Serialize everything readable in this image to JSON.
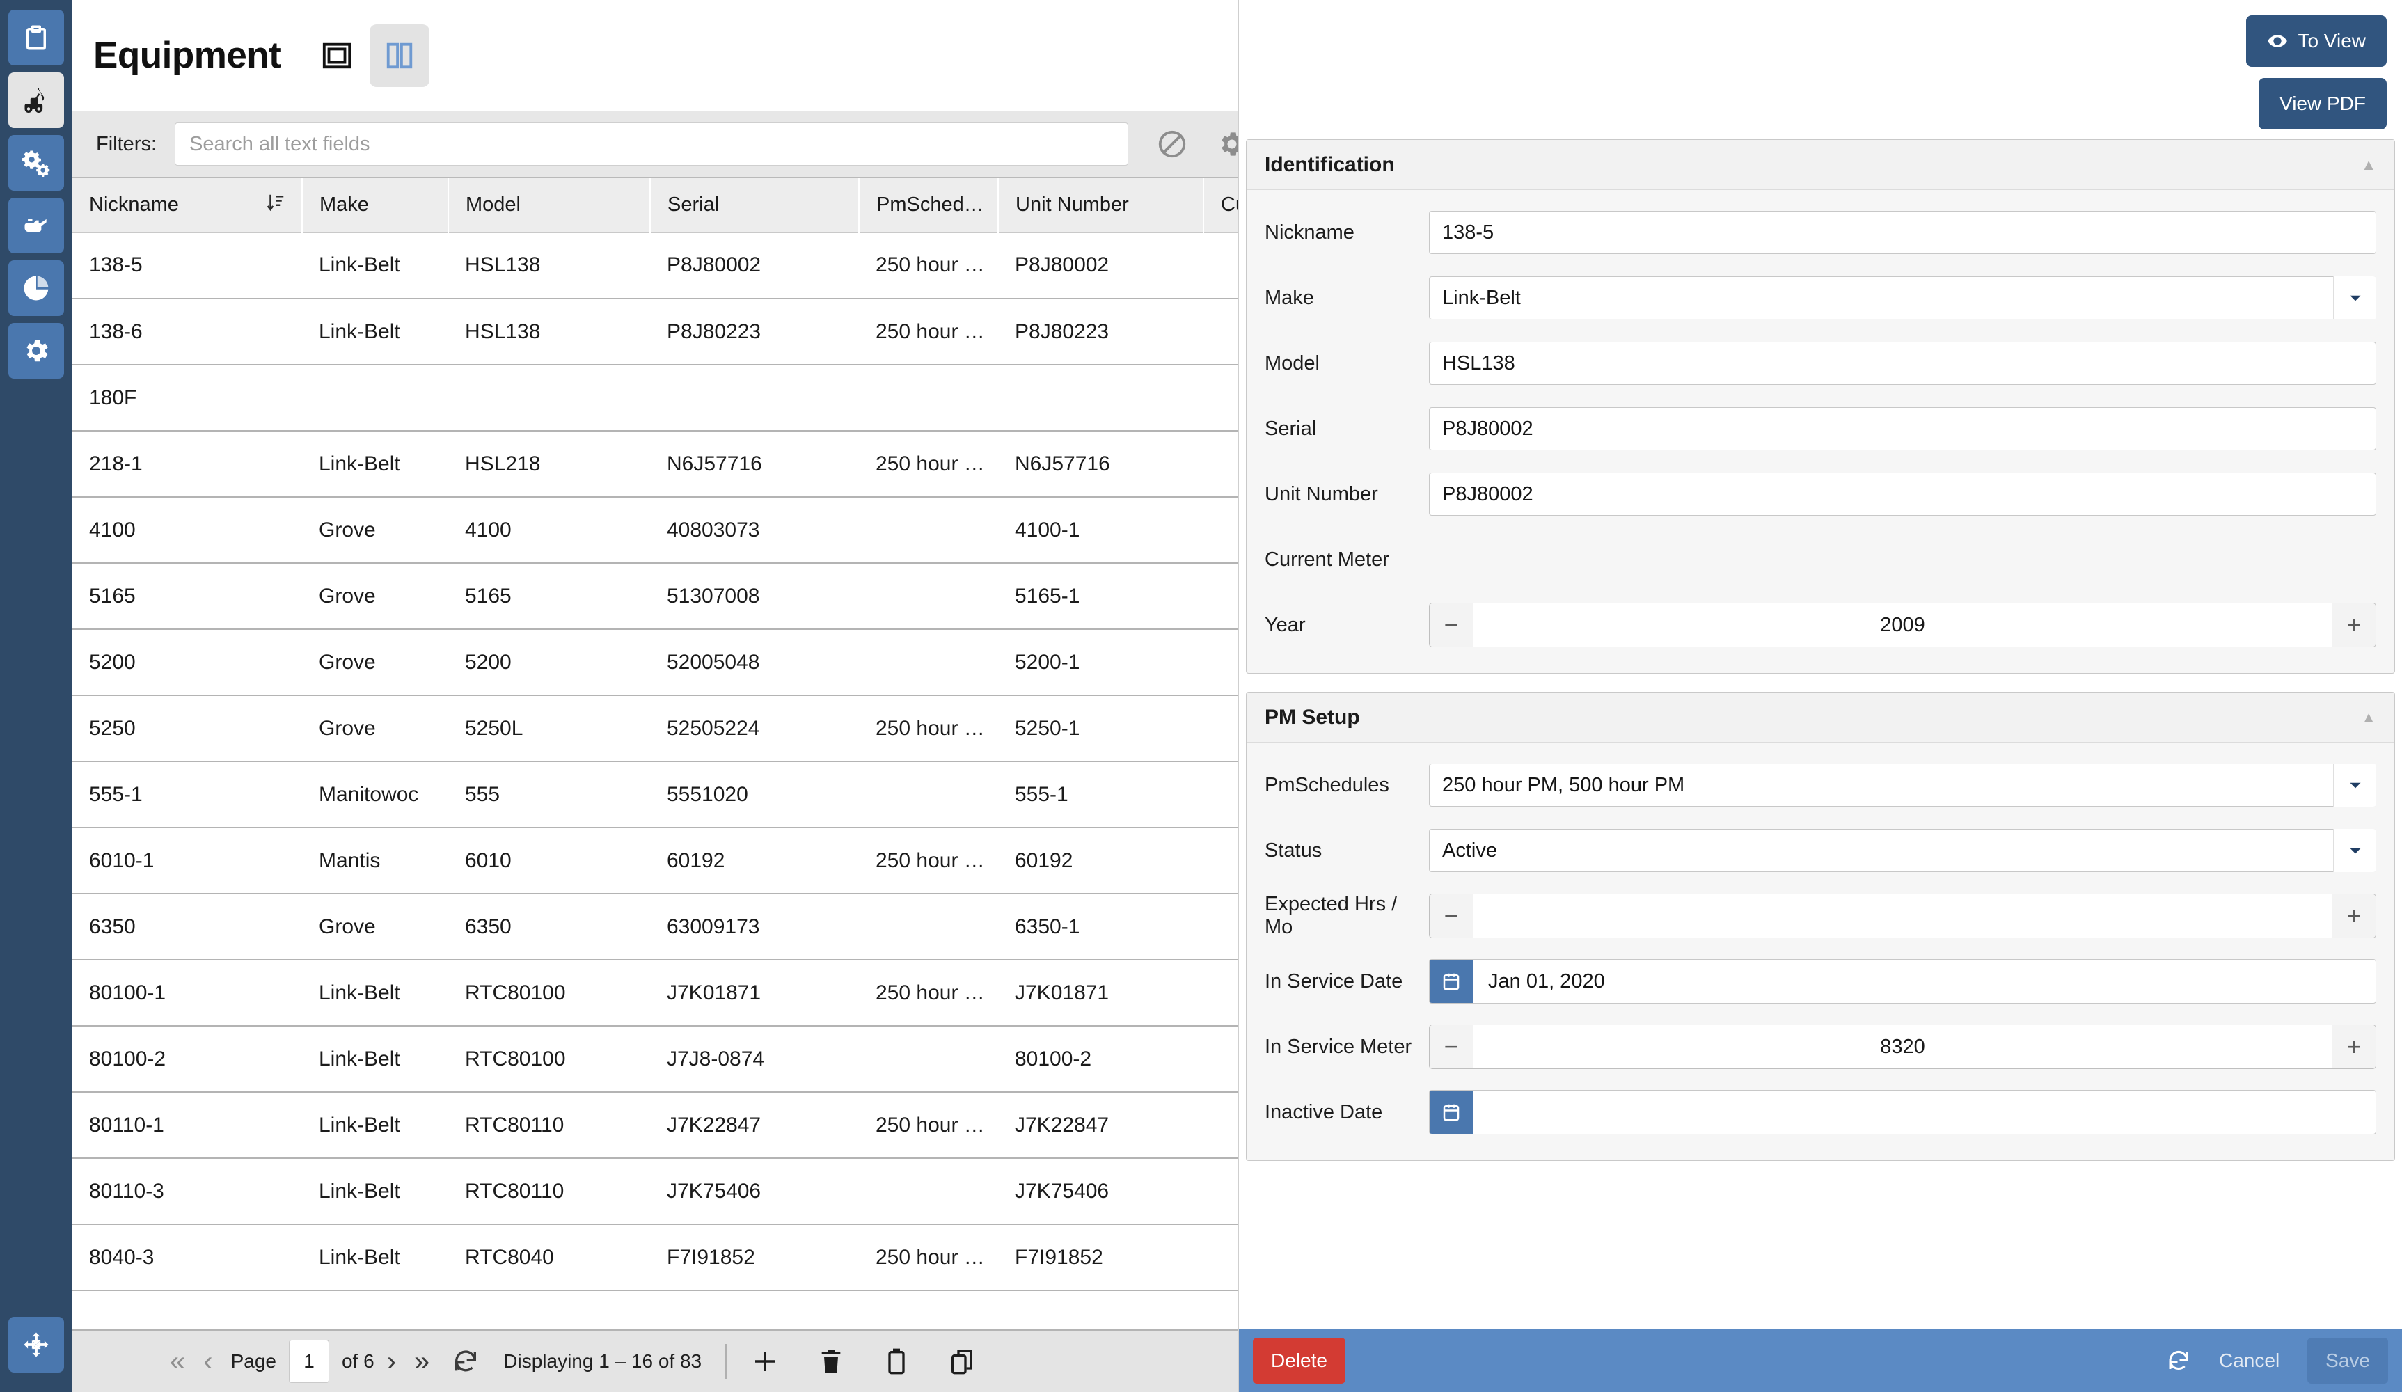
{
  "sidebar": {
    "items": [
      {
        "name": "clipboard",
        "icon": "clipboard-icon",
        "active": false
      },
      {
        "name": "equipment",
        "icon": "crane-icon",
        "active": true
      },
      {
        "name": "parts",
        "icon": "gears-icon",
        "active": false
      },
      {
        "name": "fluids",
        "icon": "oil-can-icon",
        "active": false
      },
      {
        "name": "reports",
        "icon": "pie-chart-icon",
        "active": false
      },
      {
        "name": "settings",
        "icon": "gear-icon",
        "active": false
      }
    ],
    "bottom": {
      "name": "expand",
      "icon": "expand-arrows-icon"
    }
  },
  "header": {
    "title": "Equipment",
    "view_single_icon": "single-pane-icon",
    "view_split_icon": "split-pane-icon",
    "active_view": "split"
  },
  "filters": {
    "label": "Filters:",
    "search_placeholder": "Search all text fields",
    "search_value": "",
    "clear_icon": "ban-icon",
    "settings_icon": "gear-icon"
  },
  "grid": {
    "columns": [
      {
        "key": "nickname",
        "label": "Nickname",
        "sorted": true,
        "sort_icon": "sort-ascending-icon"
      },
      {
        "key": "make",
        "label": "Make",
        "sorted": false
      },
      {
        "key": "model",
        "label": "Model",
        "sorted": false
      },
      {
        "key": "serial",
        "label": "Serial",
        "sorted": false
      },
      {
        "key": "pmschedules",
        "label": "PmSched…",
        "sorted": false
      },
      {
        "key": "unit_number",
        "label": "Unit Number",
        "sorted": false
      },
      {
        "key": "current_meter",
        "label": "Curr",
        "sorted": false
      }
    ],
    "rows": [
      {
        "nickname": "138-5",
        "make": "Link-Belt",
        "model": "HSL138",
        "serial": "P8J80002",
        "pmschedules": "250 hour …",
        "unit_number": "P8J80002",
        "current_meter": "",
        "selected": true
      },
      {
        "nickname": "138-6",
        "make": "Link-Belt",
        "model": "HSL138",
        "serial": "P8J80223",
        "pmschedules": "250 hour …",
        "unit_number": "P8J80223",
        "current_meter": "",
        "selected": false
      },
      {
        "nickname": "180F",
        "make": "",
        "model": "",
        "serial": "",
        "pmschedules": "",
        "unit_number": "",
        "current_meter": "",
        "selected": false
      },
      {
        "nickname": "218-1",
        "make": "Link-Belt",
        "model": "HSL218",
        "serial": "N6J57716",
        "pmschedules": "250 hour …",
        "unit_number": "N6J57716",
        "current_meter": "",
        "selected": false
      },
      {
        "nickname": "4100",
        "make": "Grove",
        "model": "4100",
        "serial": "40803073",
        "pmschedules": "",
        "unit_number": "4100-1",
        "current_meter": "",
        "selected": false
      },
      {
        "nickname": "5165",
        "make": "Grove",
        "model": "5165",
        "serial": "51307008",
        "pmschedules": "",
        "unit_number": "5165-1",
        "current_meter": "",
        "selected": false
      },
      {
        "nickname": "5200",
        "make": "Grove",
        "model": "5200",
        "serial": "52005048",
        "pmschedules": "",
        "unit_number": "5200-1",
        "current_meter": "",
        "selected": false
      },
      {
        "nickname": "5250",
        "make": "Grove",
        "model": "5250L",
        "serial": "52505224",
        "pmschedules": "250 hour …",
        "unit_number": "5250-1",
        "current_meter": "",
        "selected": false
      },
      {
        "nickname": "555-1",
        "make": "Manitowoc",
        "model": "555",
        "serial": "5551020",
        "pmschedules": "",
        "unit_number": "555-1",
        "current_meter": "",
        "selected": false
      },
      {
        "nickname": "6010-1",
        "make": "Mantis",
        "model": "6010",
        "serial": "60192",
        "pmschedules": "250 hour …",
        "unit_number": "60192",
        "current_meter": "",
        "selected": false
      },
      {
        "nickname": "6350",
        "make": "Grove",
        "model": "6350",
        "serial": "63009173",
        "pmschedules": "",
        "unit_number": "6350-1",
        "current_meter": "",
        "selected": false
      },
      {
        "nickname": "80100-1",
        "make": "Link-Belt",
        "model": "RTC80100",
        "serial": "J7K01871",
        "pmschedules": "250 hour …",
        "unit_number": "J7K01871",
        "current_meter": "",
        "selected": false
      },
      {
        "nickname": "80100-2",
        "make": "Link-Belt",
        "model": "RTC80100",
        "serial": "J7J8-0874",
        "pmschedules": "",
        "unit_number": "80100-2",
        "current_meter": "",
        "selected": false
      },
      {
        "nickname": "80110-1",
        "make": "Link-Belt",
        "model": "RTC80110",
        "serial": "J7K22847",
        "pmschedules": "250 hour …",
        "unit_number": "J7K22847",
        "current_meter": "",
        "selected": false
      },
      {
        "nickname": "80110-3",
        "make": "Link-Belt",
        "model": "RTC80110",
        "serial": "J7K75406",
        "pmschedules": "",
        "unit_number": "J7K75406",
        "current_meter": "",
        "selected": false
      },
      {
        "nickname": "8040-3",
        "make": "Link-Belt",
        "model": "RTC8040",
        "serial": "F7I91852",
        "pmschedules": "250 hour …",
        "unit_number": "F7I91852",
        "current_meter": "",
        "selected": false
      }
    ]
  },
  "pager": {
    "first_icon": "double-chevron-left-icon",
    "prev_icon": "chevron-left-icon",
    "page_label": "Page",
    "page_value": "1",
    "of_label": "of 6",
    "next_icon": "chevron-right-icon",
    "last_icon": "double-chevron-right-icon",
    "refresh_icon": "refresh-icon",
    "displaying": "Displaying 1 – 16 of 83",
    "add_icon": "plus-icon",
    "delete_icon": "trash-icon",
    "paste_icon": "clipboard-icon",
    "copy_icon": "copy-icon"
  },
  "detail": {
    "to_view_label": "To View",
    "to_view_icon": "eye-icon",
    "view_pdf_label": "View PDF",
    "sections": [
      {
        "title": "Identification",
        "collapse_icon": "caret-up-icon",
        "fields": [
          {
            "label": "Nickname",
            "type": "text",
            "value": "138-5"
          },
          {
            "label": "Make",
            "type": "select",
            "value": "Link-Belt"
          },
          {
            "label": "Model",
            "type": "text",
            "value": "HSL138"
          },
          {
            "label": "Serial",
            "type": "text",
            "value": "P8J80002"
          },
          {
            "label": "Unit Number",
            "type": "text",
            "value": "P8J80002"
          },
          {
            "label": "Current Meter",
            "type": "none",
            "value": ""
          },
          {
            "label": "Year",
            "type": "spin",
            "value": "2009"
          }
        ]
      },
      {
        "title": "PM Setup",
        "collapse_icon": "caret-up-icon",
        "fields": [
          {
            "label": "PmSchedules",
            "type": "select",
            "value": "250 hour PM, 500 hour PM"
          },
          {
            "label": "Status",
            "type": "select",
            "value": "Active"
          },
          {
            "label": "Expected Hrs / Mo",
            "type": "spin",
            "value": ""
          },
          {
            "label": "In Service Date",
            "type": "date",
            "value": "Jan 01, 2020"
          },
          {
            "label": "In Service Meter",
            "type": "spin",
            "value": "8320"
          },
          {
            "label": "Inactive Date",
            "type": "date",
            "value": ""
          }
        ]
      }
    ],
    "actions": {
      "delete_label": "Delete",
      "refresh_icon": "refresh-icon",
      "cancel_label": "Cancel",
      "save_label": "Save"
    }
  },
  "colors": {
    "sidebar_bg": "#2f4a68",
    "sidebar_item": "#4a77ae",
    "primary": "#31557f",
    "action_bar": "#5b8ac4",
    "danger": "#d33b33"
  }
}
